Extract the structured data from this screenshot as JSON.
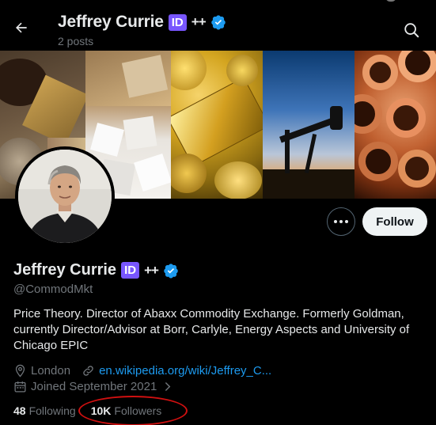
{
  "header": {
    "title": "Jeffrey Currie",
    "id_badge": "ID",
    "plus": "++",
    "posts": "2 posts"
  },
  "actions": {
    "follow_label": "Follow"
  },
  "profile": {
    "name": "Jeffrey Currie",
    "id_badge": "ID",
    "plus": "++",
    "handle": "@CommodMkt",
    "bio": "Price Theory. Director of Abaxx Commodity Exchange. Formerly Goldman, currently Director/Advisor at Borr, Carlyle, Energy Aspects and University of Chicago EPIC",
    "location": "London",
    "website": "en.wikipedia.org/wiki/Jeffrey_C...",
    "joined": "Joined September 2021",
    "following_count": "48",
    "following_label": "Following",
    "followers_count": "10K",
    "followers_label": "Followers"
  },
  "icons": {
    "back": "arrow-left-icon",
    "search": "search-icon",
    "more": "more-dots-icon",
    "verified": "verified-badge-icon",
    "location": "location-pin-icon",
    "link": "link-icon",
    "calendar": "calendar-icon",
    "chevron": "chevron-right-icon"
  },
  "colors": {
    "background": "#000000",
    "text": "#e7e9ea",
    "muted": "#71767b",
    "link": "#1d9bf0",
    "verified": "#1d9bf0",
    "id_badge": "#7856ff",
    "annotation": "#d01010"
  }
}
